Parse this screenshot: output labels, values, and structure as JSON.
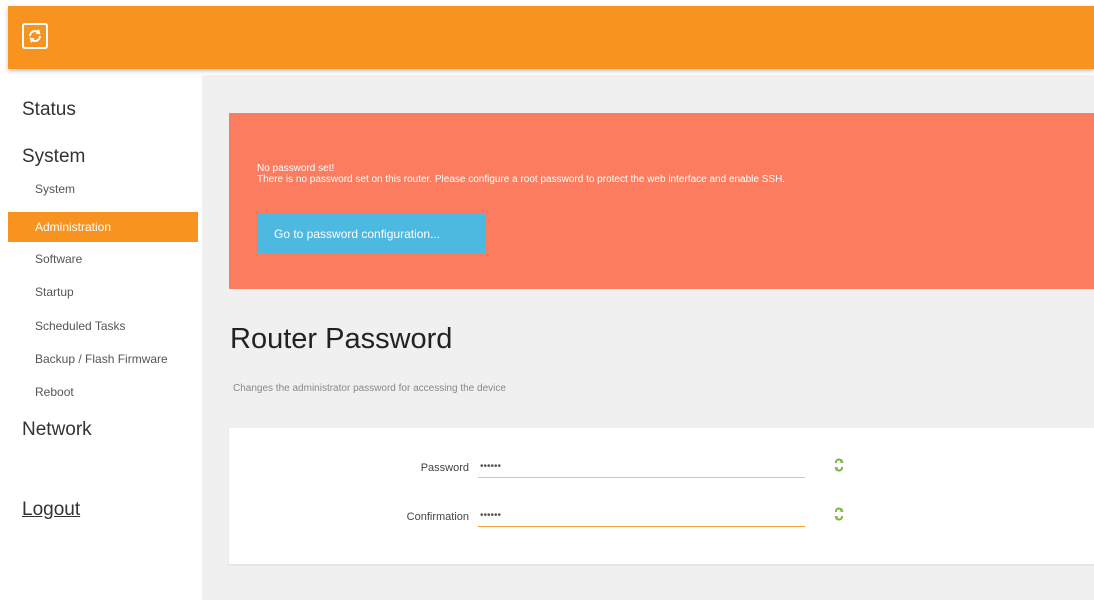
{
  "header": {
    "logo_icon": "openwrt-logo-icon",
    "color": "#f7931e"
  },
  "sidebar": {
    "sections": [
      {
        "label": "Status"
      },
      {
        "label": "System"
      },
      {
        "label": "Network"
      }
    ],
    "system_items": [
      {
        "label": "System"
      },
      {
        "label": "Administration",
        "active": true
      },
      {
        "label": "Software"
      },
      {
        "label": "Startup"
      },
      {
        "label": "Scheduled Tasks"
      },
      {
        "label": "Backup / Flash Firmware"
      },
      {
        "label": "Reboot"
      }
    ],
    "logout_label": "Logout",
    "active_color": "#f7931e"
  },
  "alert": {
    "title": "No password set!",
    "text": "There is no password set on this router. Please configure a root password to protect the web interface and enable SSH.",
    "button_label": "Go to password configuration...",
    "color": "#fb7c5e",
    "button_color": "#4db8e0"
  },
  "main": {
    "title": "Router Password",
    "description": "Changes the administrator password for accessing the device"
  },
  "form": {
    "fields": [
      {
        "label": "Password",
        "value": "••••••",
        "reveal_icon": "reveal-password-icon"
      },
      {
        "label": "Confirmation",
        "value": "••••••",
        "reveal_icon": "reveal-password-icon"
      }
    ]
  }
}
